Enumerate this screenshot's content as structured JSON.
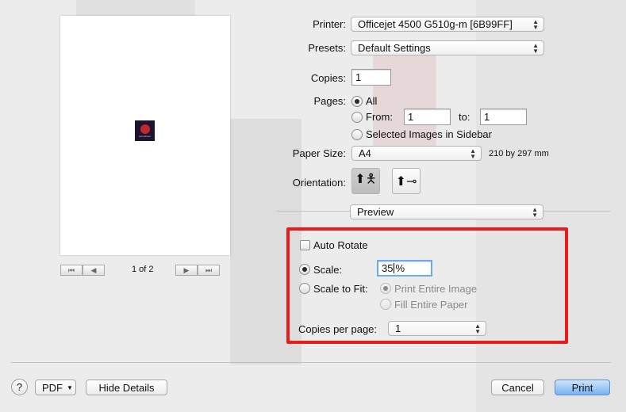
{
  "printer": {
    "label": "Printer:",
    "value": "Officejet 4500 G510g-m [6B99FF]"
  },
  "presets": {
    "label": "Presets:",
    "value": "Default Settings"
  },
  "copies": {
    "label": "Copies:",
    "value": "1"
  },
  "pages": {
    "label": "Pages:",
    "all_label": "All",
    "from_label": "From:",
    "from_value": "1",
    "to_label": "to:",
    "to_value": "1",
    "selected_label": "Selected Images in Sidebar"
  },
  "paper_size": {
    "label": "Paper Size:",
    "value": "A4",
    "dimensions": "210 by 297 mm"
  },
  "orientation": {
    "label": "Orientation:"
  },
  "section_popup": {
    "value": "Preview"
  },
  "options": {
    "auto_rotate_label": "Auto Rotate",
    "scale_label": "Scale:",
    "scale_value": "35",
    "scale_unit": "%",
    "scale_to_fit_label": "Scale to Fit:",
    "print_entire_image_label": "Print Entire Image",
    "fill_entire_paper_label": "Fill Entire Paper",
    "copies_per_page_label": "Copies per page:",
    "copies_per_page_value": "1"
  },
  "pager": {
    "count_text": "1 of 2"
  },
  "thumbnail": {
    "text": "Homebrew"
  },
  "footer": {
    "help_label": "?",
    "pdf_label": "PDF",
    "hide_details_label": "Hide Details",
    "cancel_label": "Cancel",
    "print_label": "Print"
  },
  "colors": {
    "highlight_box": "#e81c1c",
    "primary_button": "#79b2f4"
  }
}
